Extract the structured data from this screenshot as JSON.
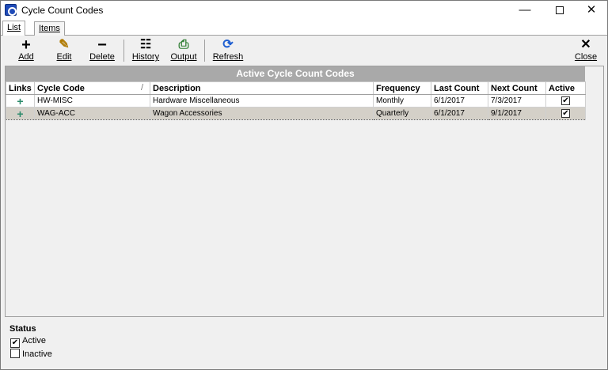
{
  "window": {
    "title": "Cycle Count Codes",
    "minimize": "—",
    "close": "✕"
  },
  "tabs": [
    {
      "label": "List",
      "selected": true
    },
    {
      "label": "Items",
      "selected": false
    }
  ],
  "toolbar": {
    "add": {
      "label": "Add",
      "icon": "plus-icon",
      "glyph": "+"
    },
    "edit": {
      "label": "Edit",
      "icon": "pencil-icon",
      "glyph": "✎"
    },
    "delete": {
      "label": "Delete",
      "icon": "minus-icon",
      "glyph": "−"
    },
    "history": {
      "label": "History",
      "icon": "history-list-icon",
      "glyph": "☷"
    },
    "output": {
      "label": "Output",
      "icon": "output-icon",
      "glyph": "⎙"
    },
    "refresh": {
      "label": "Refresh",
      "icon": "refresh-icon",
      "glyph": "⟳"
    },
    "close": {
      "label": "Close",
      "icon": "close-icon",
      "glyph": "✕"
    }
  },
  "grid": {
    "caption": "Active Cycle Count Codes",
    "sort_indicator": "/",
    "columns": [
      "Links",
      "Cycle Code",
      "Description",
      "Frequency",
      "Last Count",
      "Next Count",
      "Active"
    ],
    "rows": [
      {
        "links": "+",
        "cycle_code": "HW-MISC",
        "description": "Hardware Miscellaneous",
        "frequency": "Monthly",
        "last_count": "6/1/2017",
        "next_count": "7/3/2017",
        "active": true,
        "selected": false
      },
      {
        "links": "+",
        "cycle_code": "WAG-ACC",
        "description": "Wagon Accessories",
        "frequency": "Quarterly",
        "last_count": "6/1/2017",
        "next_count": "9/1/2017",
        "active": true,
        "selected": true
      }
    ]
  },
  "status": {
    "title": "Status",
    "options": [
      {
        "label": "Active",
        "checked": true
      },
      {
        "label": "Inactive",
        "checked": false
      }
    ]
  },
  "colors": {
    "caption_bg": "#a9a9a9",
    "link_plus": "#2a8a6a",
    "refresh_icon": "#1f5fd1",
    "output_icon": "#2e7d32",
    "app_icon": "#1f4bb8"
  }
}
